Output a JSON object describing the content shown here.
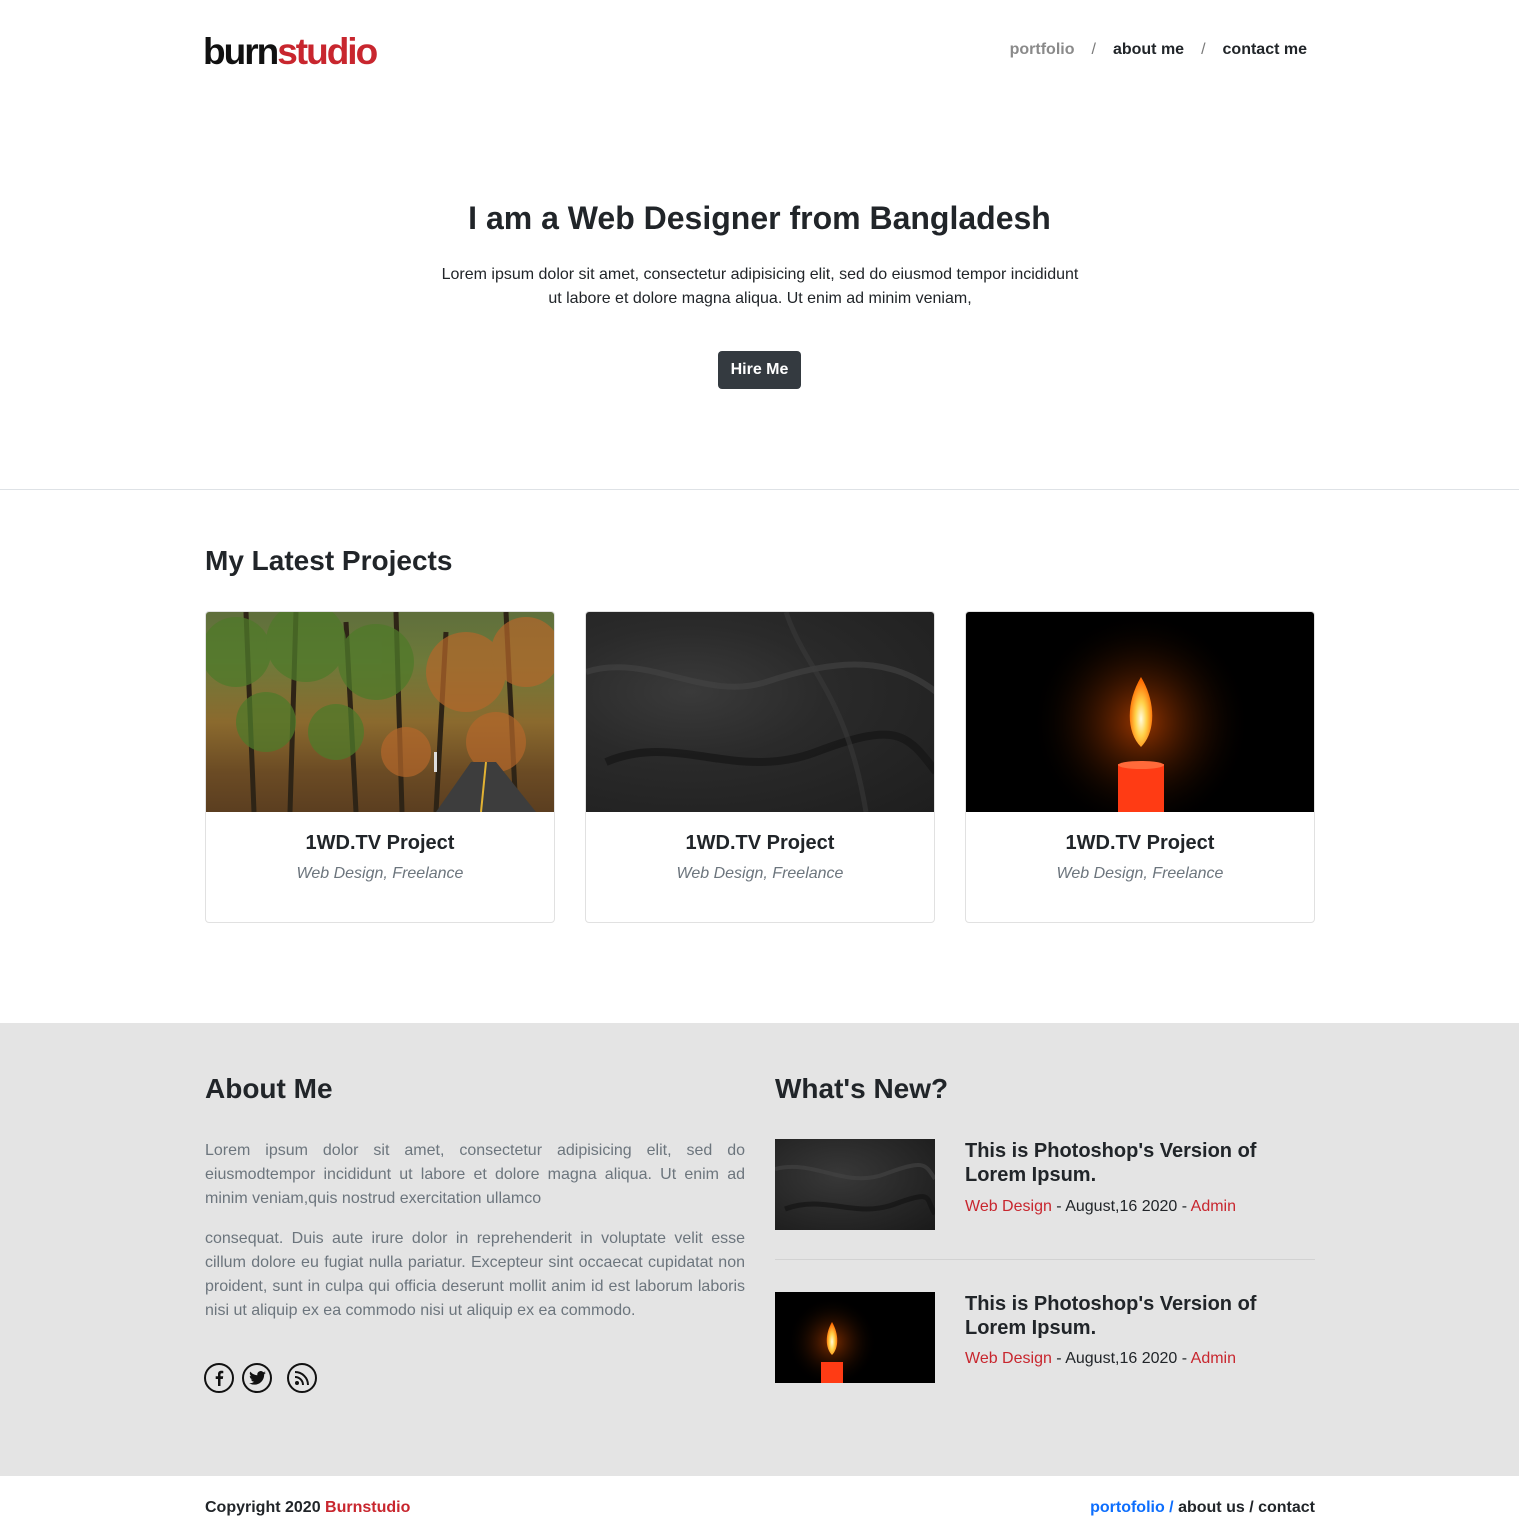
{
  "header": {
    "logo_part1": "burn",
    "logo_part2": "studio",
    "nav": [
      "portfolio",
      "about me",
      "contact me"
    ],
    "separator": "/"
  },
  "hero": {
    "title": "I am a Web Designer from Bangladesh",
    "text_line1": "Lorem ipsum dolor sit amet, consectetur adipisicing elit, sed do eiusmod tempor incididunt",
    "text_line2": "ut labore et dolore magna aliqua. Ut enim ad minim veniam,",
    "button": "Hire Me"
  },
  "projects": {
    "title": "My Latest Projects",
    "cards": [
      {
        "title": "1WD.TV Project",
        "subtitle": "Web Design, Freelance",
        "image": "forest-road"
      },
      {
        "title": "1WD.TV Project",
        "subtitle": "Web Design, Freelance",
        "image": "dark-sand"
      },
      {
        "title": "1WD.TV Project",
        "subtitle": "Web Design, Freelance",
        "image": "candle"
      }
    ]
  },
  "about": {
    "title": "About Me",
    "p1": "Lorem ipsum dolor sit amet, consectetur adipisicing elit, sed do eiusmodtempor incididunt ut labore et dolore magna aliqua. Ut enim ad minim veniam,quis nostrud exercitation ullamco",
    "p2": "consequat. Duis aute irure dolor in reprehenderit in voluptate velit esse cillum dolore eu fugiat nulla pariatur. Excepteur sint occaecat cupidatat non proident, sunt in culpa qui officia deserunt mollit anim id est laborum laboris nisi ut aliquip ex ea commodo nisi ut aliquip ex ea commodo.",
    "social_icons": [
      "facebook-icon",
      "twitter-icon",
      "rss-icon"
    ]
  },
  "whats_new": {
    "title": "What's New?",
    "items": [
      {
        "headline": "This is Photoshop's Version of Lorem Ipsum.",
        "category": "Web Design",
        "dash1": " - ",
        "date": "August,16 2020",
        "dash2": " - ",
        "author": "Admin",
        "image": "dark-sand"
      },
      {
        "headline": "This is Photoshop's Version of Lorem Ipsum.",
        "category": "Web Design",
        "dash1": " - ",
        "date": "August,16 2020",
        "dash2": " - ",
        "author": "Admin",
        "image": "candle"
      }
    ]
  },
  "footer": {
    "copyright": "Copyright 2020 ",
    "brand": "Burnstudio",
    "link1": "portofolio",
    "link2": "about us",
    "link3": "contact",
    "separator": " / "
  },
  "colors": {
    "accent_red": "#c8262e",
    "button_dark": "#343a40",
    "link_blue": "#0d6efd",
    "section_gray": "#e4e4e4"
  }
}
